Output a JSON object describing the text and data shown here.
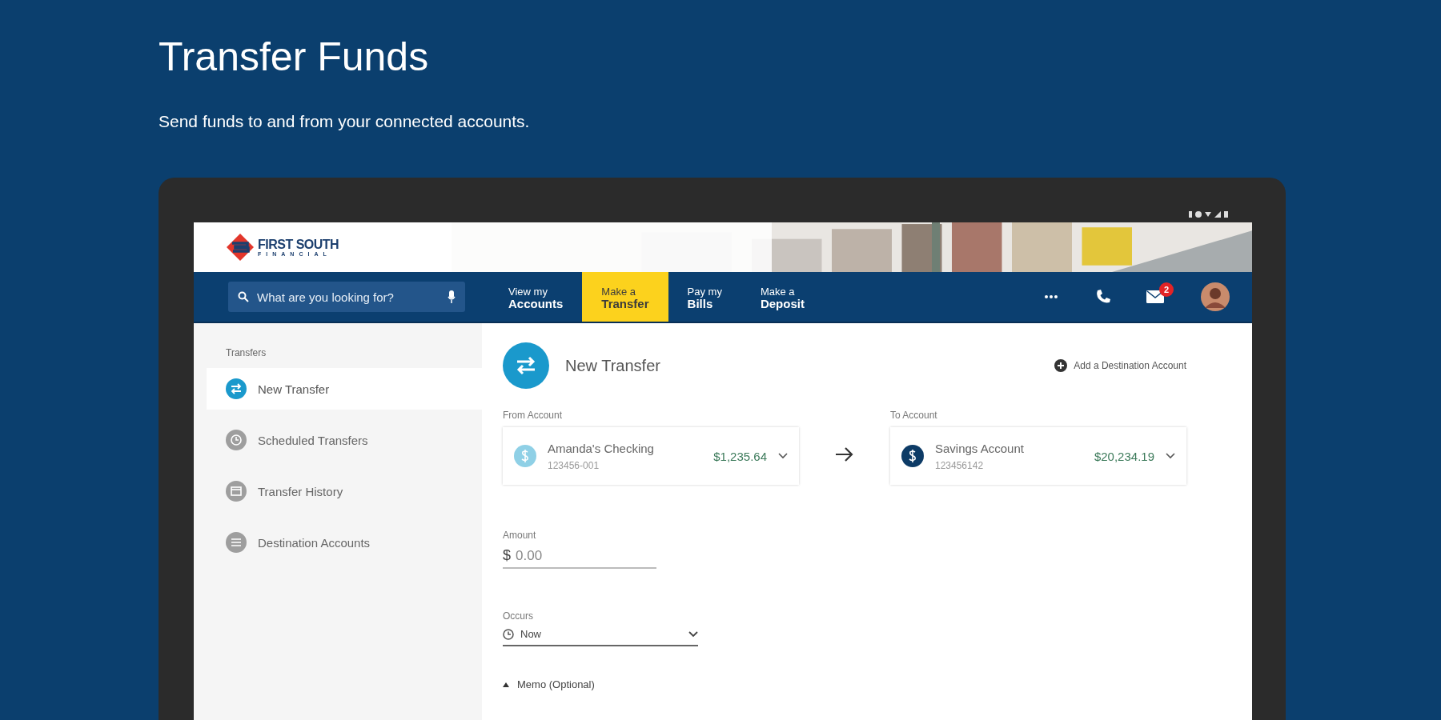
{
  "page": {
    "title": "Transfer Funds",
    "subtitle": "Send funds to and from your connected accounts."
  },
  "app": {
    "logo": {
      "name": "FIRST SOUTH",
      "tagline": "FINANCIAL"
    },
    "search": {
      "placeholder": "What are you looking for?"
    },
    "nav": [
      {
        "line1": "View my",
        "line2": "Accounts",
        "selected": false
      },
      {
        "line1": "Make a",
        "line2": "Transfer",
        "selected": true
      },
      {
        "line1": "Pay my",
        "line2": "Bills",
        "selected": false
      },
      {
        "line1": "Make a",
        "line2": "Deposit",
        "selected": false
      }
    ],
    "mail_badge": "2",
    "sidebar": {
      "heading": "Transfers",
      "items": [
        {
          "label": "New Transfer",
          "kind": "transfer",
          "selected": true
        },
        {
          "label": "Scheduled Transfers",
          "kind": "scheduled",
          "selected": false
        },
        {
          "label": "Transfer History",
          "kind": "history",
          "selected": false
        },
        {
          "label": "Destination Accounts",
          "kind": "accounts",
          "selected": false
        }
      ]
    },
    "transfer": {
      "title": "New Transfer",
      "add_link": "Add a Destination Account",
      "accounts": [
        {
          "label": "From Account",
          "name": "Amanda's Checking",
          "number": "123456-001",
          "balance": "$1,235.64",
          "color": "#8fd0e6"
        },
        {
          "label": "To Account",
          "name": "Savings Account",
          "number": "123456142",
          "balance": "$20,234.19",
          "color": "#0d3b66"
        }
      ],
      "amount": {
        "label": "Amount",
        "currency": "$",
        "placeholder": "0.00"
      },
      "occurs": {
        "label": "Occurs",
        "value": "Now"
      },
      "memo": {
        "label": "Memo (Optional)"
      }
    }
  }
}
